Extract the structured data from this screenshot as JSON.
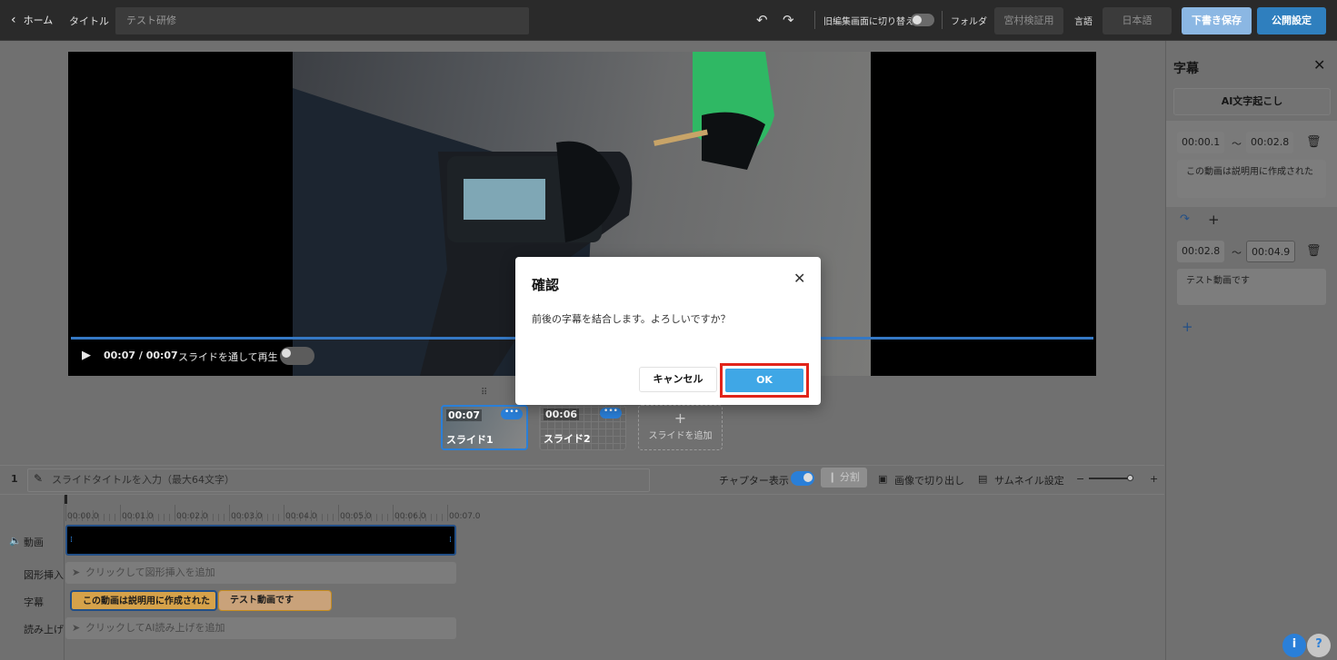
{
  "topbar": {
    "back_label": "ホーム",
    "title_label": "タイトル",
    "title_value": "テスト研修",
    "old_editor_label": "旧編集画面に切り替え",
    "folder_label": "フォルダ",
    "folder_value": "宮村検証用",
    "language_label": "言語",
    "language_value": "日本語",
    "save_draft_label": "下書き保存",
    "publish_label": "公開設定"
  },
  "player": {
    "time": "00:07 / 00:07",
    "play_through_label": "スライドを通して再生"
  },
  "slides": [
    {
      "time": "00:07",
      "name": "スライド1"
    },
    {
      "time": "00:06",
      "name": "スライド2"
    }
  ],
  "add_slide_label": "スライドを追加",
  "slide_row": {
    "index": "1",
    "title_placeholder": "スライドタイトルを入力（最大64文字）",
    "chapter_label": "チャプター表示",
    "split_label": "分割",
    "crop_label": "画像で切り出し",
    "thumbnail_label": "サムネイル設定"
  },
  "timeline": {
    "ticks": [
      "00:00.0",
      "00:01.0",
      "00:02.0",
      "00:03.0",
      "00:04.0",
      "00:05.0",
      "00:06.0",
      "00:07.0"
    ],
    "tracks": {
      "video": "動画",
      "shape": "図形挿入",
      "subtitle": "字幕",
      "narration": "読み上げ"
    },
    "shape_hint": "クリックして図形挿入を追加",
    "narration_hint": "クリックしてAI読み上げを追加",
    "subtitle_clips": [
      "この動画は説明用に作成された",
      "テスト動画です"
    ]
  },
  "panel": {
    "title": "字幕",
    "ai_label": "AI文字起こし",
    "subtitles": [
      {
        "start": "00:00.1",
        "end": "00:02.8",
        "text": "この動画は説明用に作成された"
      },
      {
        "start": "00:02.8",
        "end": "00:04.9",
        "text": "テスト動画です"
      }
    ],
    "separator": "〜"
  },
  "modal": {
    "title": "確認",
    "message": "前後の字幕を結合します。よろしいですか？",
    "cancel_label": "キャンセル",
    "ok_label": "OK"
  },
  "colors": {
    "accent": "#2a7fd8",
    "ok": "#3fa7e6",
    "highlight": "#e1241a",
    "subtitle_clip": "#d6a24a"
  }
}
